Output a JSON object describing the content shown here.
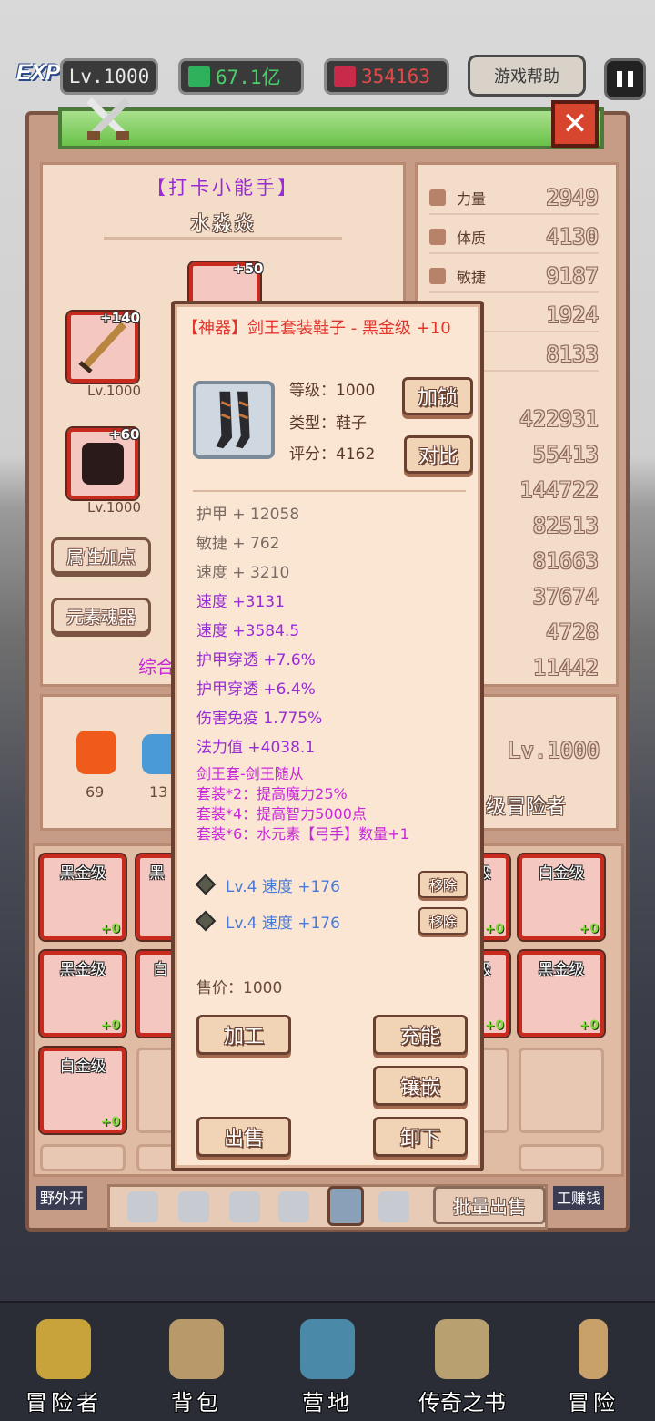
{
  "topbar": {
    "exp_badge": "EXP",
    "level": "Lv.1000",
    "gold": "67.1亿",
    "gems": "354163",
    "help": "游戏帮助"
  },
  "character": {
    "title": "【打卡小能手】",
    "name": "水淼焱",
    "slots": [
      {
        "plus": "+50"
      },
      {
        "plus": "+140",
        "level": "Lv.1000"
      },
      {
        "plus": "+60",
        "level": "Lv.1000"
      }
    ],
    "buttons": [
      "属性加点",
      "元素魂器"
    ],
    "partial_label": "综合",
    "elements": [
      "69",
      "13"
    ],
    "adv_level": "Lv.1000",
    "adv_rank_partial": "级冒险者"
  },
  "stats": [
    {
      "label": "力量",
      "value": "2949"
    },
    {
      "label": "体质",
      "value": "4130"
    },
    {
      "label": "敏捷",
      "value": "9187"
    },
    {
      "label": "",
      "value": "1924"
    },
    {
      "label": "",
      "value": "8133"
    }
  ],
  "stats2": [
    "422931",
    "55413",
    "144722",
    "82513",
    "81663",
    "37674",
    "4728",
    "11442"
  ],
  "popup": {
    "title": "【神器】剑王套装鞋子 - 黑金级 +10",
    "level": "等级：1000",
    "type": "类型：鞋子",
    "score": "评分：4162",
    "lock_btn": "加锁",
    "compare_btn": "对比",
    "base_attrs": [
      "护甲 + 12058",
      "敏捷 + 762",
      "速度 + 3210"
    ],
    "bonus_attrs": [
      "速度 +3131",
      "速度 +3584.5",
      "护甲穿透 +7.6%",
      "护甲穿透 +6.4%",
      "伤害免疫 1.775%",
      "法力值 +4038.1"
    ],
    "set_lines": [
      "剑王套-剑王随从",
      "套装*2：提高魔力25%",
      "套装*4：提高智力5000点",
      "套装*6：水元素【弓手】数量+1"
    ],
    "gems": [
      {
        "text": "Lv.4 速度 +176",
        "btn": "移除"
      },
      {
        "text": "Lv.4 速度 +176",
        "btn": "移除"
      }
    ],
    "price": "售价：1000",
    "btn_process": "加工",
    "btn_charge": "充能",
    "btn_inlay": "镶嵌",
    "btn_sell": "出售",
    "btn_unequip": "卸下"
  },
  "inventory": [
    {
      "grade": "黑金级",
      "plus": "+0"
    },
    {
      "grade": "黑",
      "plus": ""
    },
    {
      "grade": "级",
      "plus": "+0"
    },
    {
      "grade": "白金级",
      "plus": "+0"
    },
    {
      "grade": "黑金级",
      "plus": "+0"
    },
    {
      "grade": "白",
      "plus": ""
    },
    {
      "grade": "级",
      "plus": "+0"
    },
    {
      "grade": "黑金级",
      "plus": "+0"
    },
    {
      "grade": "白金级",
      "plus": "+0"
    }
  ],
  "tabs": {
    "batch_sell": "批量出售",
    "left_tag": "野外开",
    "right_tag": "工赚钱"
  },
  "nav": [
    "冒险者",
    "背包",
    "营地",
    "传奇之书",
    "冒险"
  ],
  "colors": {
    "grade_frame": "#c82a1e",
    "popup_title": "#e2362c",
    "bonus_attr": "#9a2ad8",
    "set_attr": "#c828d8",
    "gem_attr": "#4a7ad8"
  }
}
